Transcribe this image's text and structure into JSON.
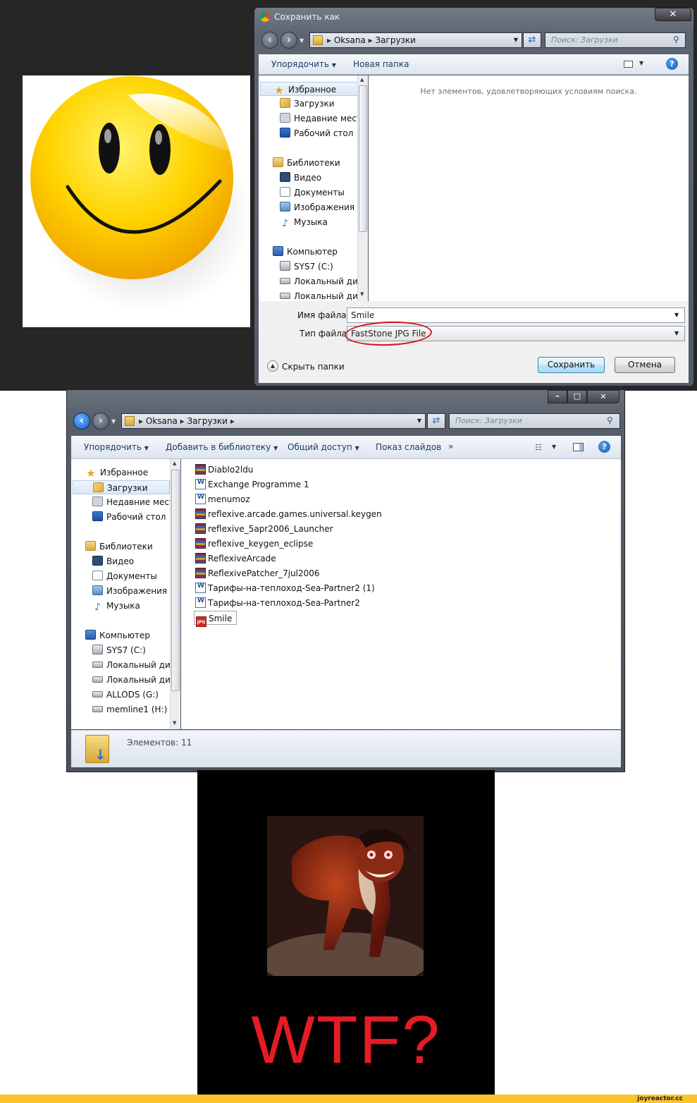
{
  "save_dialog": {
    "title": "Сохранить как",
    "close": "✕",
    "breadcrumb": [
      "Oksana",
      "Загрузки"
    ],
    "search_placeholder": "Поиск: Загрузки",
    "toolbar": {
      "organize": "Упорядочить",
      "new_folder": "Новая папка"
    },
    "nav": {
      "favorites": "Избранное",
      "downloads": "Загрузки",
      "recent": "Недавние места",
      "desktop": "Рабочий стол",
      "libraries": "Библиотеки",
      "video": "Видео",
      "documents": "Документы",
      "images": "Изображения",
      "music": "Музыка",
      "computer": "Компьютер",
      "sys7": "SYS7 (C:)",
      "local1": "Локальный диск",
      "local2": "Локальный диск"
    },
    "empty_message": "Нет элементов, удовлетворяющих условиям поиска.",
    "filename_label": "Имя файла:",
    "filename_value": "Smile",
    "filetype_label": "Тип файла:",
    "filetype_value": "FastStone JPG File",
    "hide_folders": "Скрыть папки",
    "save_button": "Сохранить",
    "cancel_button": "Отмена"
  },
  "explorer": {
    "breadcrumb": [
      "Oksana",
      "Загрузки"
    ],
    "search_placeholder": "Поиск: Загрузки",
    "toolbar": {
      "organize": "Упорядочить",
      "add_library": "Добавить в библиотеку",
      "share": "Общий доступ",
      "slideshow": "Показ слайдов",
      "more": "»"
    },
    "nav": {
      "favorites": "Избранное",
      "downloads": "Загрузки",
      "recent": "Недавние места",
      "desktop": "Рабочий стол",
      "libraries": "Библиотеки",
      "video": "Видео",
      "documents": "Документы",
      "images": "Изображения",
      "music": "Музыка",
      "computer": "Компьютер",
      "sys7": "SYS7 (C:)",
      "local1": "Локальный диск",
      "local2": "Локальный диск",
      "allods": "ALLODS (G:)",
      "memline": "memline1 (H:)"
    },
    "files": [
      {
        "name": "Diablo2ldu",
        "type": "rar"
      },
      {
        "name": "Exchange Programme 1",
        "type": "doc"
      },
      {
        "name": "menumoz",
        "type": "doc"
      },
      {
        "name": "reflexive.arcade.games.universal.keygen",
        "type": "rar"
      },
      {
        "name": "reflexive_5apr2006_Launcher",
        "type": "rar"
      },
      {
        "name": "reflexive_keygen_eclipse",
        "type": "rar"
      },
      {
        "name": "ReflexiveArcade",
        "type": "rar"
      },
      {
        "name": "ReflexivePatcher_7jul2006",
        "type": "rar"
      },
      {
        "name": "Тарифы-на-теплоход-Sea-Partner2 (1)",
        "type": "doc"
      },
      {
        "name": "Тарифы-на-теплоход-Sea-Partner2",
        "type": "doc"
      },
      {
        "name": "Smile",
        "type": "jpg"
      }
    ],
    "jpg_badge": "JPG",
    "status": "Элементов: 11"
  },
  "caption": "WTF?",
  "watermark": "joyreactor.cc"
}
